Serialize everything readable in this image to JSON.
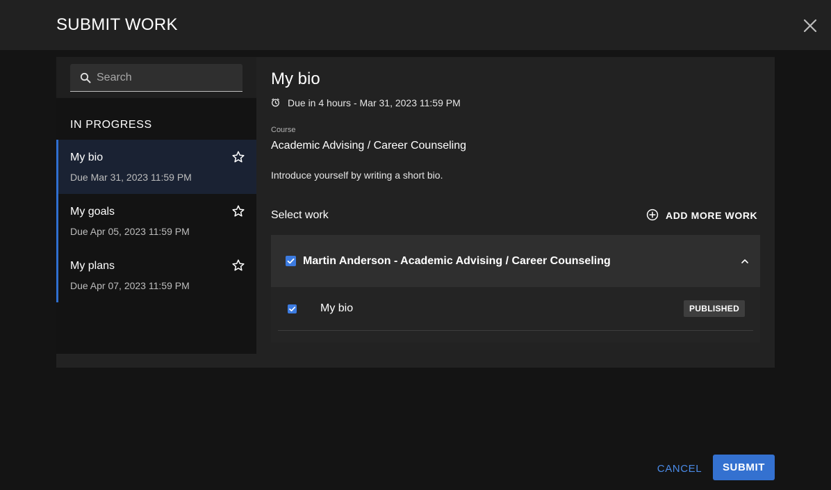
{
  "dialog": {
    "title": "SUBMIT WORK"
  },
  "search": {
    "placeholder": "Search",
    "value": ""
  },
  "sidebar": {
    "section_label": "IN PROGRESS",
    "items": [
      {
        "name": "My bio",
        "due": "Due Mar 31, 2023 11:59 PM",
        "selected": true
      },
      {
        "name": "My goals",
        "due": "Due Apr 05, 2023 11:59 PM",
        "selected": false
      },
      {
        "name": "My plans",
        "due": "Due Apr 07, 2023 11:59 PM",
        "selected": false
      }
    ]
  },
  "detail": {
    "title": "My bio",
    "due_text": "Due in 4 hours - Mar 31, 2023 11:59 PM",
    "course_label": "Course",
    "course_value": "Academic Advising / Career Counseling",
    "instructions": "Introduce yourself by writing a short bio.",
    "select_label": "Select work",
    "add_more_label": "ADD MORE WORK",
    "group": {
      "label": "Martin Anderson - Academic Advising / Career Counseling",
      "checked": true,
      "expanded": true,
      "items": [
        {
          "name": "My bio",
          "status": "PUBLISHED",
          "checked": true
        }
      ]
    }
  },
  "footer": {
    "cancel_label": "CANCEL",
    "submit_label": "SUBMIT"
  },
  "colors": {
    "accent": "#3471d0",
    "link": "#4a8ae6",
    "selected_bg": "#1a2233"
  }
}
